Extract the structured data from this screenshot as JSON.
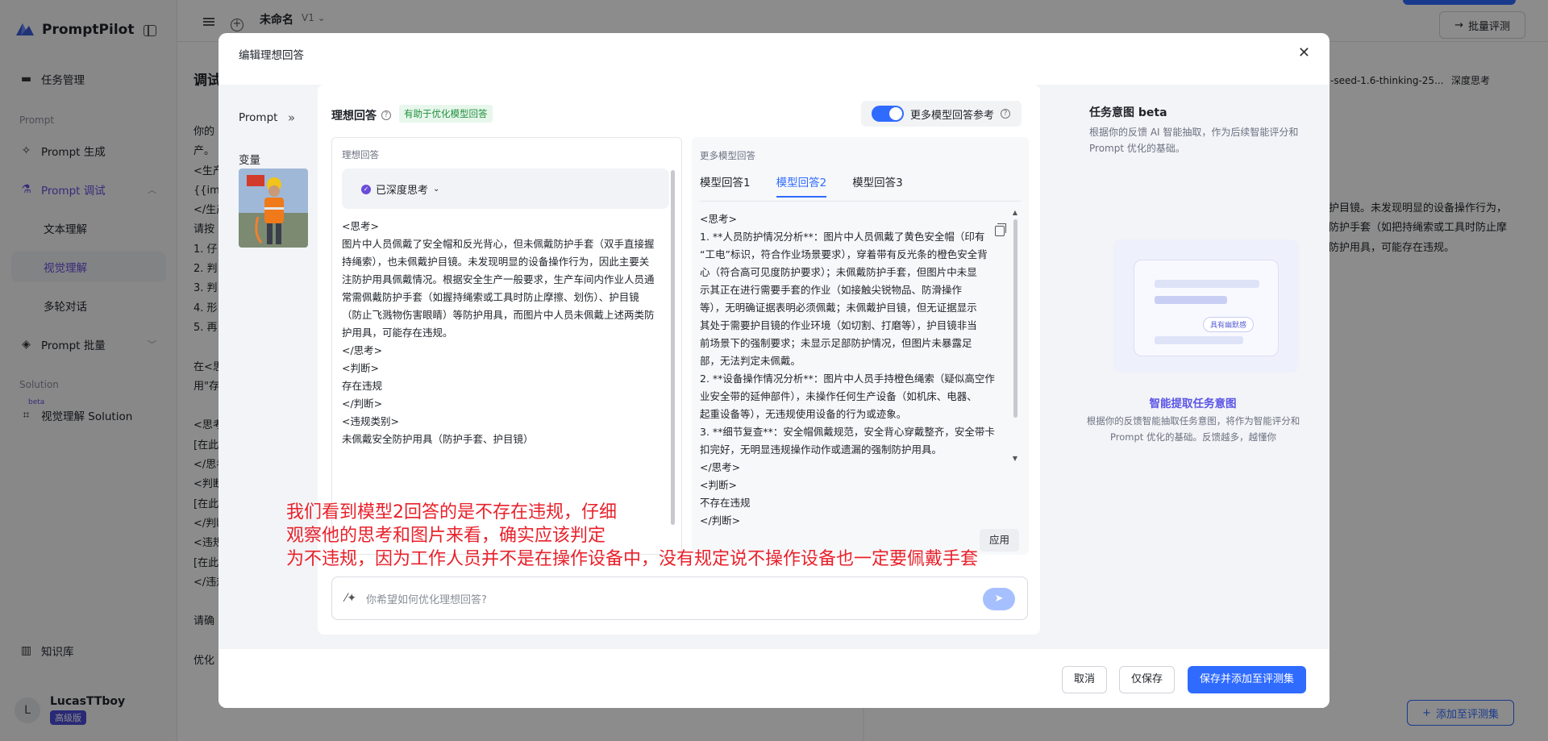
{
  "app": {
    "name": "PromptPilot",
    "doc_title": "未命名",
    "version": "V1",
    "batch_eval_button": "批量评测",
    "add_to_evalset_button": "添加至评测集"
  },
  "sidebar": {
    "task_mgmt": "任务管理",
    "section_prompt": "Prompt",
    "prompt_gen": "Prompt 生成",
    "prompt_debug": "Prompt 调试",
    "text_understanding": "文本理解",
    "visual_understanding": "视觉理解",
    "multi_turn": "多轮对话",
    "prompt_batch": "Prompt 批量",
    "section_solution": "Solution",
    "beta": "beta",
    "visual_solution": "视觉理解 Solution",
    "knowledge_base": "知识库",
    "user_initial": "L",
    "user_name": "LucasTTboy",
    "user_tier": "高级版"
  },
  "background": {
    "debug_heading": "调试",
    "left_lines": [
      "你的",
      "产。",
      "<生产",
      "{{ima",
      "</生产",
      "请按",
      "1. 仔",
      "2. 判",
      "3. 判",
      "4. 形",
      "5. 再",
      "",
      "在<思",
      "用\"存",
      "",
      "<思考",
      "[在此",
      "</思考",
      "<判断",
      "[在此",
      "</判断",
      "<违规",
      "[在此",
      "</违规",
      "",
      "请确",
      "",
      "优化"
    ],
    "model_label": "-seed-1.6-thinking-25...",
    "deep_think": "深度思考",
    "right_lines": [
      "护目镜。未发现明显的设备操作行为，",
      "防护手套（如把持绳索或工具时防止摩",
      "防护用具，可能存在违规。"
    ]
  },
  "modal": {
    "title": "编辑理想回答",
    "left": {
      "prompt_label": "Prompt",
      "variables_label": "变量"
    },
    "ideal": {
      "heading": "理想回答",
      "tag": "有助于优化模型回答",
      "box_label": "理想回答",
      "thinking_status": "已深度思考",
      "lines": [
        "<思考>",
        "图片中人员佩戴了安全帽和反光背心，但未佩戴防护手套（双手直接握",
        "持绳索），也未佩戴护目镜。未发现明显的设备操作行为，因此主要关",
        "注防护用具佩戴情况。根据安全生产一般要求，生产车间内作业人员通",
        "常需佩戴防护手套（如握持绳索或工具时防止摩擦、划伤）、护目镜",
        "（防止飞溅物伤害眼睛）等防护用具，而图片中人员未佩戴上述两类防",
        "护用具，可能存在违规。",
        "</思考>",
        "<判断>",
        "存在违规",
        "</判断>",
        "<违规类别>",
        "未佩戴安全防护用具（防护手套、护目镜）"
      ]
    },
    "more": {
      "toggle_label": "更多模型回答参考",
      "box_label": "更多模型回答",
      "tabs": [
        "模型回答1",
        "模型回答2",
        "模型回答3"
      ],
      "active_tab": 1,
      "lines": [
        "<思考>",
        "1. **人员防护情况分析**：图片中人员佩戴了黄色安全帽（印有",
        "“工电”标识，符合作业场景要求），穿着带有反光条的橙色安全背",
        "心（符合高可见度防护要求）；未佩戴防护手套，但图片中未显",
        "示其正在进行需要手套的作业（如接触尖锐物品、防滑操作",
        "等），无明确证据表明必须佩戴；未佩戴护目镜，但无证据显示",
        "其处于需要护目镜的作业环境（如切割、打磨等），护目镜非当",
        "前场景下的强制要求；未显示足部防护情况，但图片未暴露足",
        "部，无法判定未佩戴。",
        "2. **设备操作情况分析**：图片中人员手持橙色绳索（疑似高空作",
        "业安全带的延伸部件），未操作任何生产设备（如机床、电器、",
        "起重设备等），无违规使用设备的行为或迹象。",
        "3. **细节复查**：安全帽佩戴规范，安全背心穿戴整齐，安全带卡",
        "扣完好，无明显违规操作动作或遗漏的强制防护用具。",
        "</思考>",
        "<判断>",
        "不存在违规",
        "</判断>"
      ],
      "apply_button": "应用"
    },
    "optimize_placeholder": "你希望如何优化理想回答?",
    "intent": {
      "title": "任务意图 beta",
      "desc": "根据你的反馈 AI 智能抽取，作为后续智能评分和 Prompt 优化的基础。",
      "chip": "具有幽默感",
      "link": "智能提取任务意图",
      "sub": "根据你的反馈智能抽取任务意图，将作为智能评分和 Prompt 优化的基础。反馈越多，越懂你"
    },
    "footer": {
      "cancel": "取消",
      "save_only": "仅保存",
      "save_add": "保存并添加至评测集"
    }
  },
  "annotation": {
    "lines": [
      "我们看到模型2回答的是不存在违规，仔细",
      "观察他的思考和图片来看，确实应该判定",
      "为不违规，因为工作人员并不是在操作设备中，没有规定说不操作设备也一定要佩戴手套"
    ],
    "color": "#e8212b"
  },
  "colors": {
    "accent": "#2f6bff",
    "brand_purple": "#6a4cdb"
  }
}
